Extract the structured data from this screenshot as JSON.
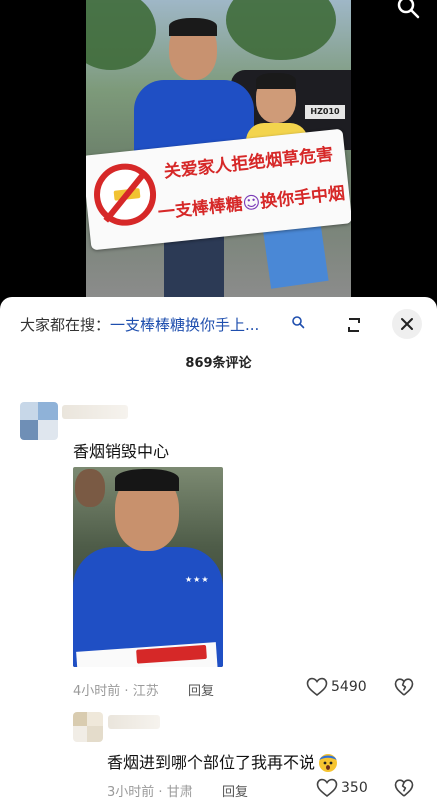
{
  "video": {
    "sign_line1": "关爱家人拒绝烟草危害",
    "sign_line2_a": "一支棒棒糖",
    "sign_line2_b": "换你手中烟",
    "plate": "HZ010"
  },
  "sheet": {
    "search_prefix": "大家都在搜：",
    "search_keyword": "一支棒棒糖换你手上...",
    "comment_count": "869条评论"
  },
  "comments": [
    {
      "text": "香烟销毁中心",
      "time": "4小时前",
      "region": "江苏",
      "reply_label": "回复",
      "likes": "5490",
      "image_stars": "★★★"
    },
    {
      "text": "香烟进到哪个部位了我再不说",
      "time": "3小时前",
      "region": "甘肃",
      "reply_label": "回复",
      "likes": "350"
    }
  ],
  "colors": {
    "accent_blue": "#1f4fae",
    "meta_gray": "#9a9a9a",
    "sign_red": "#d62828"
  }
}
